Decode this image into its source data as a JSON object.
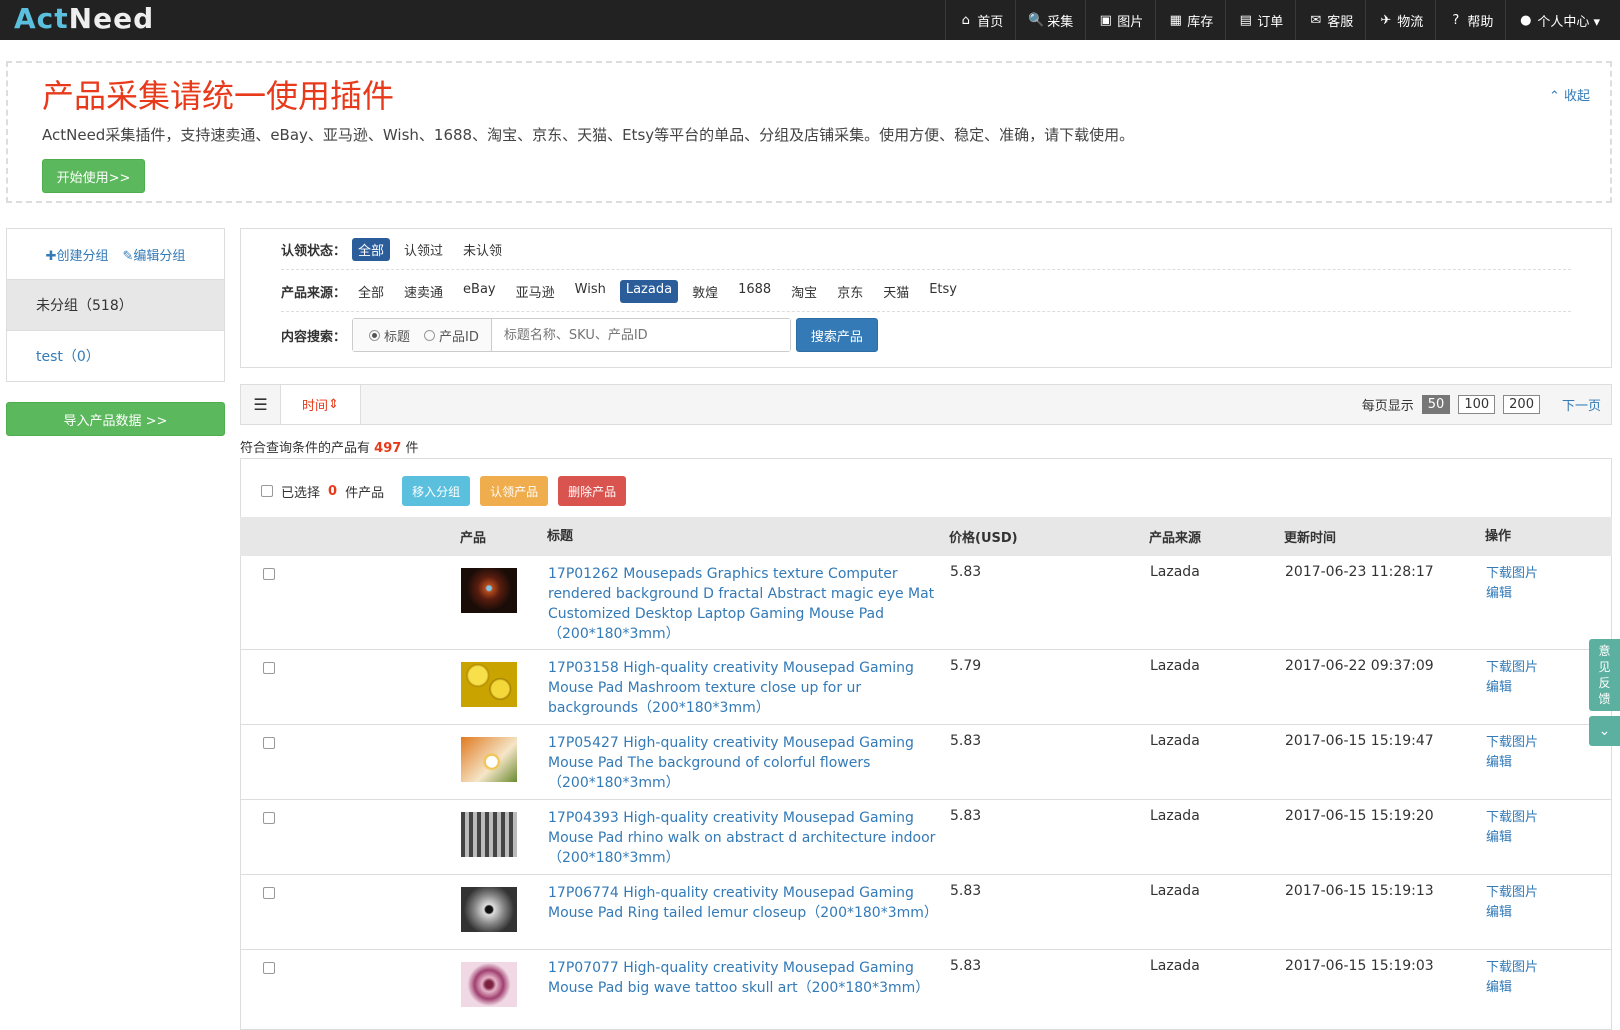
{
  "brand": {
    "part1": "Act",
    "part2": "Need"
  },
  "nav": [
    {
      "icon": "home-icon",
      "glyph": "⌂",
      "label": "首页"
    },
    {
      "icon": "search-icon",
      "glyph": "🔍",
      "label": "采集"
    },
    {
      "icon": "picture-icon",
      "glyph": "▣",
      "label": "图片"
    },
    {
      "icon": "grid-icon",
      "glyph": "▦",
      "label": "库存"
    },
    {
      "icon": "list-icon",
      "glyph": "▤",
      "label": "订单"
    },
    {
      "icon": "mail-icon",
      "glyph": "✉",
      "label": "客服"
    },
    {
      "icon": "plane-icon",
      "glyph": "✈",
      "label": "物流"
    },
    {
      "icon": "help-icon",
      "glyph": "?",
      "label": "帮助"
    },
    {
      "icon": "user-icon",
      "glyph": "●",
      "label": "个人中心 ▾"
    }
  ],
  "banner": {
    "title": "产品采集请统一使用插件",
    "desc": "ActNeed采集插件，支持速卖通、eBay、亚马逊、Wish、1688、淘宝、京东、天猫、Etsy等平台的单品、分组及店铺采集。使用方便、稳定、准确，请下载使用。",
    "start_btn": "开始使用>>",
    "collapse": "收起"
  },
  "groups": {
    "create": "创建分组",
    "edit": "编辑分组",
    "items": [
      {
        "label": "未分组（518）"
      },
      {
        "label": "test（0）"
      }
    ],
    "import_btn": "导入产品数据 >>"
  },
  "filter": {
    "status_label": "认领状态：",
    "status_opts": [
      "全部",
      "认领过",
      "未认领"
    ],
    "source_label": "产品来源：",
    "source_opts": [
      "全部",
      "速卖通",
      "eBay",
      "亚马逊",
      "Wish",
      "Lazada",
      "敦煌",
      "1688",
      "淘宝",
      "京东",
      "天猫",
      "Etsy"
    ],
    "search_label": "内容搜索：",
    "radio_title": "标题",
    "radio_id": "产品ID",
    "placeholder": "标题名称、SKU、产品ID",
    "search_btn": "搜索产品"
  },
  "toolbar": {
    "sort": "时间",
    "per_page_label": "每页显示",
    "per_page": [
      "50",
      "100",
      "200"
    ],
    "next": "下一页"
  },
  "count": {
    "prefix": "符合查询条件的产品有",
    "value": "497",
    "suffix": "件"
  },
  "bulk": {
    "prefix": "已选择",
    "value": "0",
    "suffix": "件产品",
    "move": "移入分组",
    "claim": "认领产品",
    "delete": "删除产品"
  },
  "table": {
    "headers": [
      "产品",
      "标题",
      "价格(USD)",
      "产品来源",
      "更新时间",
      "操作"
    ],
    "rows": [
      {
        "title": "17P01262 Mousepads Graphics texture Computer rendered background D fractal Abstract magic eye Mat Customized Desktop Laptop Gaming Mouse Pad （200*180*3mm）",
        "price": "5.83",
        "source": "Lazada",
        "time": "2017-06-23 11:28:17",
        "thumb": "fractal"
      },
      {
        "title": "17P03158 High-quality creativity Mousepad Gaming Mouse Pad Mashroom texture close up for ur backgrounds（200*180*3mm）",
        "price": "5.79",
        "source": "Lazada",
        "time": "2017-06-22 09:37:09",
        "thumb": "yellow"
      },
      {
        "title": "17P05427 High-quality creativity Mousepad Gaming Mouse Pad The background of colorful flowers （200*180*3mm）",
        "price": "5.83",
        "source": "Lazada",
        "time": "2017-06-15 15:19:47",
        "thumb": "flowers"
      },
      {
        "title": "17P04393 High-quality creativity Mousepad Gaming Mouse Pad rhino walk on abstract d architecture indoor （200*180*3mm）",
        "price": "5.83",
        "source": "Lazada",
        "time": "2017-06-15 15:19:20",
        "thumb": "rhino"
      },
      {
        "title": "17P06774 High-quality creativity Mousepad Gaming Mouse Pad Ring tailed lemur closeup（200*180*3mm）",
        "price": "5.83",
        "source": "Lazada",
        "time": "2017-06-15 15:19:13",
        "thumb": "lemur"
      },
      {
        "title": "17P07077 High-quality creativity Mousepad Gaming Mouse Pad big wave tattoo skull art（200*180*3mm）",
        "price": "5.83",
        "source": "Lazada",
        "time": "2017-06-15 15:19:03",
        "thumb": "tattoo"
      }
    ],
    "op_download": "下载图片",
    "op_edit": "编辑"
  },
  "feedback": {
    "label": [
      "意",
      "见",
      "反",
      "馈"
    ]
  }
}
